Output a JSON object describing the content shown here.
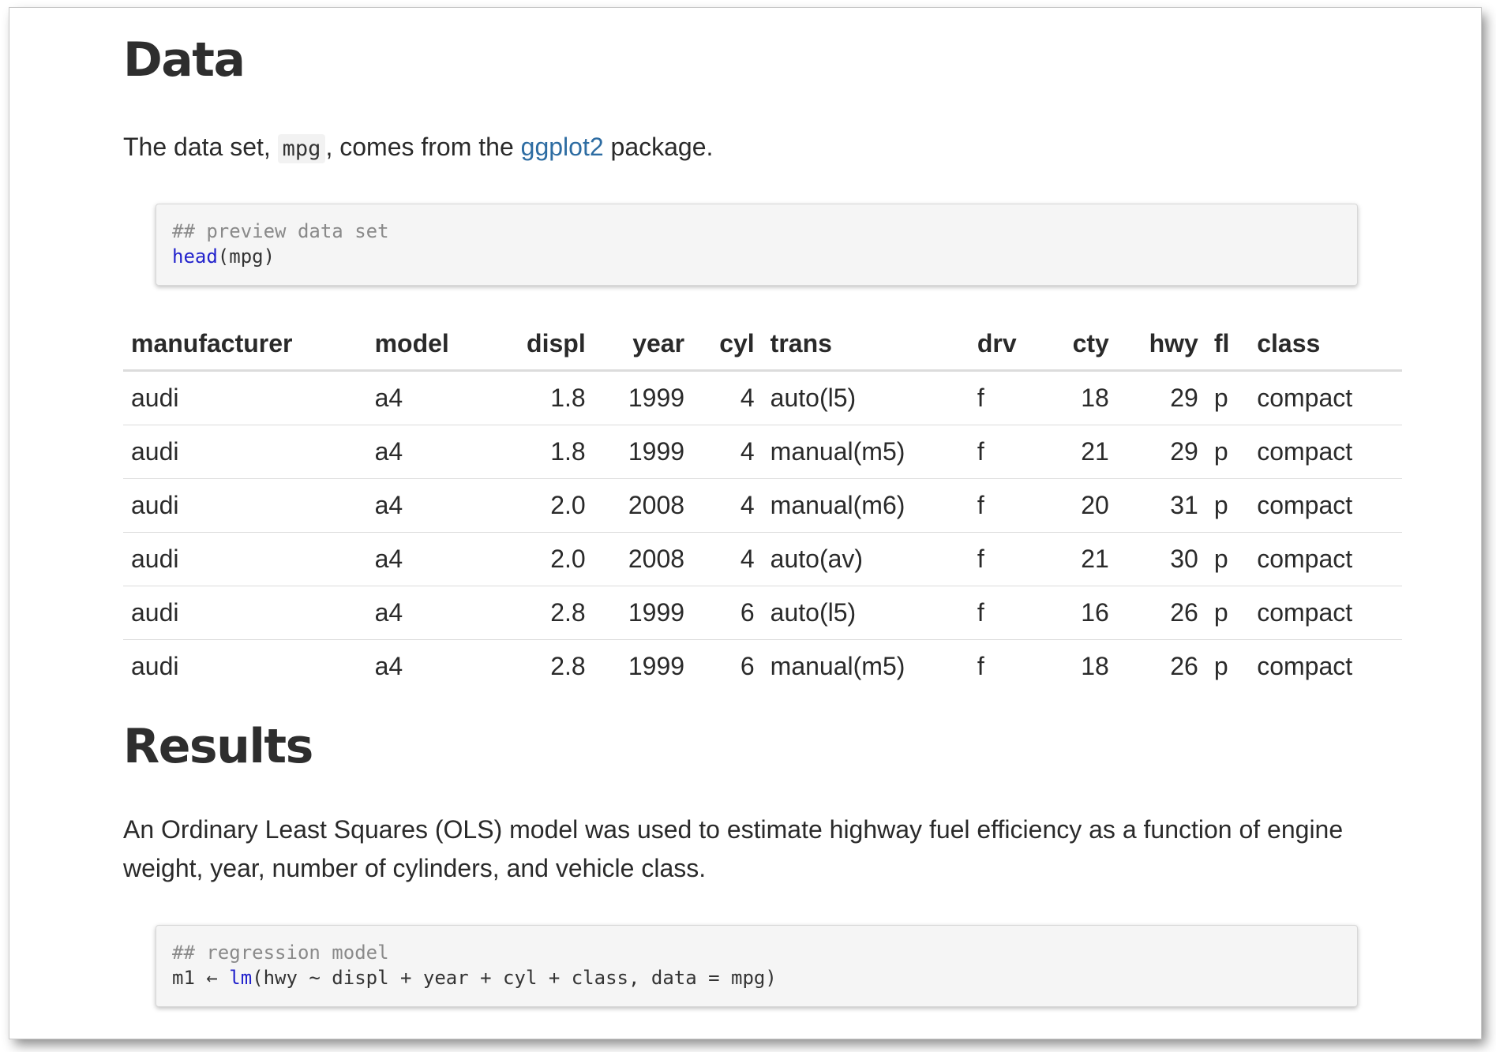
{
  "sections": {
    "data": {
      "heading": "Data",
      "intro": {
        "before": "The data set, ",
        "code": "mpg",
        "middle": ", comes from the ",
        "link": "ggplot2",
        "after": " package."
      },
      "code_block": {
        "comment": "## preview data set",
        "fn": "head",
        "args": "(mpg)"
      }
    },
    "results": {
      "heading": "Results",
      "text": "An Ordinary Least Squares (OLS) model was used to estimate highway fuel efficiency as a function of engine weight, year, number of cylinders, and vehicle class.",
      "code_block": {
        "comment": "## regression model",
        "prefix": "m1 ← ",
        "fn": "lm",
        "args": "(hwy ~ displ + year + cyl + class, data = mpg)"
      }
    }
  },
  "table": {
    "columns": [
      {
        "label": "manufacturer",
        "align": "left"
      },
      {
        "label": "model",
        "align": "left"
      },
      {
        "label": "displ",
        "align": "right"
      },
      {
        "label": "year",
        "align": "right"
      },
      {
        "label": "cyl",
        "align": "right"
      },
      {
        "label": "trans",
        "align": "left"
      },
      {
        "label": "drv",
        "align": "left"
      },
      {
        "label": "cty",
        "align": "right"
      },
      {
        "label": "hwy",
        "align": "right"
      },
      {
        "label": "fl",
        "align": "left"
      },
      {
        "label": "class",
        "align": "left"
      }
    ],
    "rows": [
      [
        "audi",
        "a4",
        "1.8",
        "1999",
        "4",
        "auto(l5)",
        "f",
        "18",
        "29",
        "p",
        "compact"
      ],
      [
        "audi",
        "a4",
        "1.8",
        "1999",
        "4",
        "manual(m5)",
        "f",
        "21",
        "29",
        "p",
        "compact"
      ],
      [
        "audi",
        "a4",
        "2.0",
        "2008",
        "4",
        "manual(m6)",
        "f",
        "20",
        "31",
        "p",
        "compact"
      ],
      [
        "audi",
        "a4",
        "2.0",
        "2008",
        "4",
        "auto(av)",
        "f",
        "21",
        "30",
        "p",
        "compact"
      ],
      [
        "audi",
        "a4",
        "2.8",
        "1999",
        "6",
        "auto(l5)",
        "f",
        "16",
        "26",
        "p",
        "compact"
      ],
      [
        "audi",
        "a4",
        "2.8",
        "1999",
        "6",
        "manual(m5)",
        "f",
        "18",
        "26",
        "p",
        "compact"
      ]
    ]
  }
}
